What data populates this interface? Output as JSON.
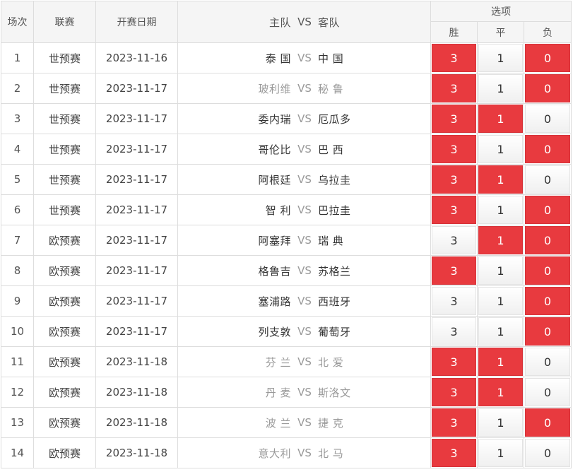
{
  "header": {
    "col_index": "场次",
    "col_league": "联赛",
    "col_date": "开赛日期",
    "col_home": "主队",
    "col_vs": "VS",
    "col_away": "客队",
    "col_options": "选项",
    "opt_win": "胜",
    "opt_draw": "平",
    "opt_loss": "负"
  },
  "vs_label": "VS",
  "colors": {
    "selected": "#e83a3f",
    "dim_text": "#999999"
  },
  "matches": [
    {
      "index": "1",
      "league": "世预赛",
      "date": "2023-11-16",
      "home": "泰 国",
      "away": "中 国",
      "home_dim": false,
      "away_dim": false,
      "win": "3",
      "draw": "1",
      "loss": "0",
      "sel": [
        true,
        false,
        true
      ]
    },
    {
      "index": "2",
      "league": "世预赛",
      "date": "2023-11-17",
      "home": "玻利维",
      "away": "秘 鲁",
      "home_dim": true,
      "away_dim": true,
      "win": "3",
      "draw": "1",
      "loss": "0",
      "sel": [
        true,
        false,
        true
      ]
    },
    {
      "index": "3",
      "league": "世预赛",
      "date": "2023-11-17",
      "home": "委内瑞",
      "away": "厄瓜多",
      "home_dim": false,
      "away_dim": false,
      "win": "3",
      "draw": "1",
      "loss": "0",
      "sel": [
        true,
        true,
        false
      ]
    },
    {
      "index": "4",
      "league": "世预赛",
      "date": "2023-11-17",
      "home": "哥伦比",
      "away": "巴 西",
      "home_dim": false,
      "away_dim": false,
      "win": "3",
      "draw": "1",
      "loss": "0",
      "sel": [
        true,
        false,
        true
      ]
    },
    {
      "index": "5",
      "league": "世预赛",
      "date": "2023-11-17",
      "home": "阿根廷",
      "away": "乌拉圭",
      "home_dim": false,
      "away_dim": false,
      "win": "3",
      "draw": "1",
      "loss": "0",
      "sel": [
        true,
        true,
        false
      ]
    },
    {
      "index": "6",
      "league": "世预赛",
      "date": "2023-11-17",
      "home": "智 利",
      "away": "巴拉圭",
      "home_dim": false,
      "away_dim": false,
      "win": "3",
      "draw": "1",
      "loss": "0",
      "sel": [
        true,
        false,
        true
      ]
    },
    {
      "index": "7",
      "league": "欧预赛",
      "date": "2023-11-17",
      "home": "阿塞拜",
      "away": "瑞 典",
      "home_dim": false,
      "away_dim": false,
      "win": "3",
      "draw": "1",
      "loss": "0",
      "sel": [
        false,
        true,
        true
      ]
    },
    {
      "index": "8",
      "league": "欧预赛",
      "date": "2023-11-17",
      "home": "格鲁吉",
      "away": "苏格兰",
      "home_dim": false,
      "away_dim": false,
      "win": "3",
      "draw": "1",
      "loss": "0",
      "sel": [
        true,
        false,
        true
      ]
    },
    {
      "index": "9",
      "league": "欧预赛",
      "date": "2023-11-17",
      "home": "塞浦路",
      "away": "西班牙",
      "home_dim": false,
      "away_dim": false,
      "win": "3",
      "draw": "1",
      "loss": "0",
      "sel": [
        false,
        false,
        true
      ]
    },
    {
      "index": "10",
      "league": "欧预赛",
      "date": "2023-11-17",
      "home": "列支敦",
      "away": "葡萄牙",
      "home_dim": false,
      "away_dim": false,
      "win": "3",
      "draw": "1",
      "loss": "0",
      "sel": [
        false,
        false,
        true
      ]
    },
    {
      "index": "11",
      "league": "欧预赛",
      "date": "2023-11-18",
      "home": "芬 兰",
      "away": "北 爱",
      "home_dim": true,
      "away_dim": true,
      "win": "3",
      "draw": "1",
      "loss": "0",
      "sel": [
        true,
        true,
        false
      ]
    },
    {
      "index": "12",
      "league": "欧预赛",
      "date": "2023-11-18",
      "home": "丹 麦",
      "away": "斯洛文",
      "home_dim": true,
      "away_dim": true,
      "win": "3",
      "draw": "1",
      "loss": "0",
      "sel": [
        true,
        true,
        false
      ]
    },
    {
      "index": "13",
      "league": "欧预赛",
      "date": "2023-11-18",
      "home": "波 兰",
      "away": "捷 克",
      "home_dim": true,
      "away_dim": true,
      "win": "3",
      "draw": "1",
      "loss": "0",
      "sel": [
        true,
        false,
        true
      ]
    },
    {
      "index": "14",
      "league": "欧预赛",
      "date": "2023-11-18",
      "home": "意大利",
      "away": "北 马",
      "home_dim": true,
      "away_dim": true,
      "win": "3",
      "draw": "1",
      "loss": "0",
      "sel": [
        true,
        false,
        false
      ]
    }
  ]
}
